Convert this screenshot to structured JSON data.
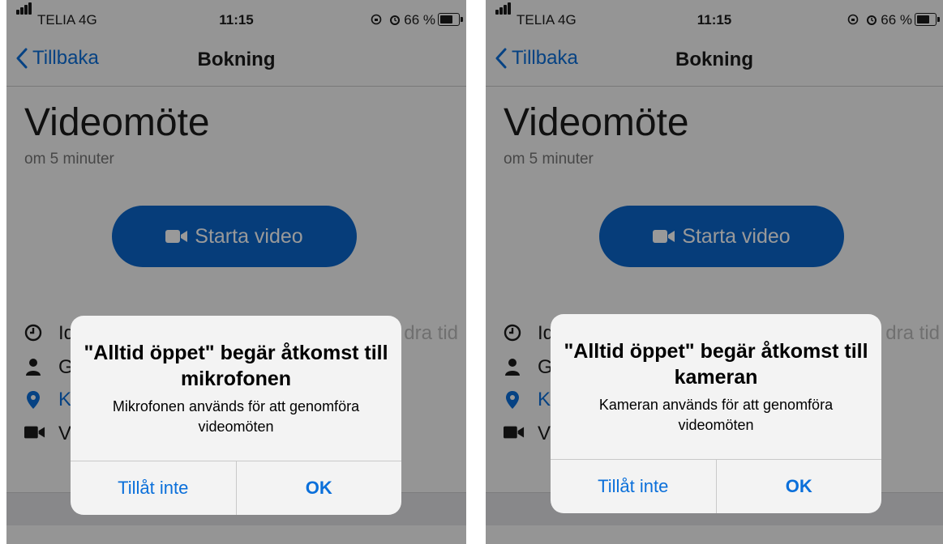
{
  "screens": [
    {
      "status_bar": {
        "carrier": "TELIA  4G",
        "time": "11:15",
        "battery_text": "66 %",
        "battery_level": 0.66
      },
      "nav": {
        "back_label": "Tillbaka",
        "title": "Bokning"
      },
      "booking": {
        "title": "Videomöte",
        "subtitle": "om 5 minuter",
        "start_button": "Starta video",
        "info_rows": [
          "Id",
          "Gu",
          "Ki",
          "Vi"
        ],
        "change_time": "dra tid"
      },
      "dialog": {
        "title": "\"Alltid öppet\" begär åtkomst till mikrofonen",
        "message": "Mikrofonen används för att genomföra videomöten",
        "deny": "Tillåt inte",
        "allow": "OK"
      }
    },
    {
      "status_bar": {
        "carrier": "TELIA  4G",
        "time": "11:15",
        "battery_text": "66 %",
        "battery_level": 0.66
      },
      "nav": {
        "back_label": "Tillbaka",
        "title": "Bokning"
      },
      "booking": {
        "title": "Videomöte",
        "subtitle": "om 5 minuter",
        "start_button": "Starta video",
        "info_rows": [
          "Id",
          "Gu",
          "Ki",
          "Vi"
        ],
        "change_time": "dra tid"
      },
      "dialog": {
        "title": "\"Alltid öppet\" begär åtkomst till kameran",
        "message": "Kameran används för att genomföra videomöten",
        "deny": "Tillåt inte",
        "allow": "OK"
      }
    }
  ],
  "colors": {
    "accent": "#0a6fda",
    "button": "#0a66cc",
    "link": "#0a6fda"
  },
  "icons": [
    "signal-icon",
    "orientation-lock-icon",
    "alarm-icon",
    "battery-icon",
    "chevron-left-icon",
    "video-camera-icon",
    "clock-icon",
    "person-icon",
    "location-pin-icon"
  ]
}
